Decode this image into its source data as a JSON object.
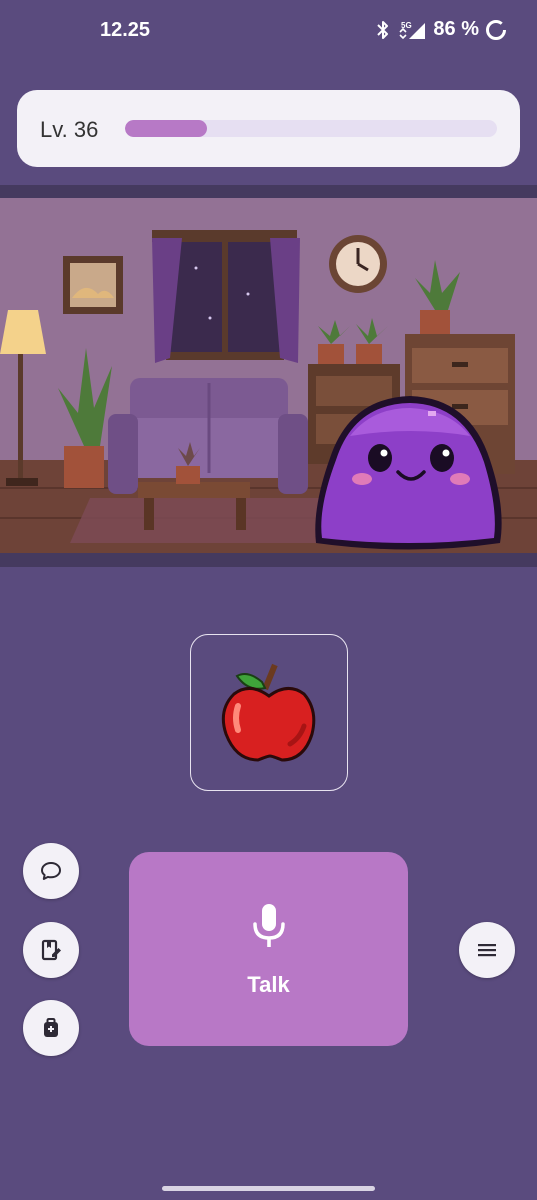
{
  "status_bar": {
    "time": "12.25",
    "battery_text": "86 %",
    "icons": [
      "bluetooth-icon",
      "signal-5g-icon",
      "battery-ring-icon"
    ]
  },
  "level": {
    "label": "Lv. 36",
    "progress_percent": 22
  },
  "scene": {
    "description_icons": [
      "room-background",
      "slime-pet"
    ]
  },
  "food": {
    "icon": "apple-icon"
  },
  "side_buttons": {
    "left": [
      "chat-bubble-icon",
      "journal-edit-icon",
      "backpack-icon"
    ],
    "right": [
      "menu-icon"
    ]
  },
  "talk": {
    "label": "Talk",
    "icon": "microphone-icon"
  },
  "colors": {
    "background": "#5a4b7e",
    "accent": "#b878c6",
    "card": "#f3f1f7"
  }
}
